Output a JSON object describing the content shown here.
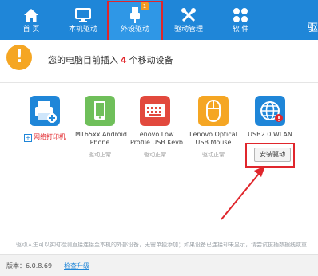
{
  "nav": {
    "items": [
      {
        "label": "首 页",
        "icon": "home-icon"
      },
      {
        "label": "本机驱动",
        "icon": "monitor-icon"
      },
      {
        "label": "外设驱动",
        "icon": "usb-icon",
        "badge": "1",
        "active": true
      },
      {
        "label": "驱动管理",
        "icon": "tools-icon"
      },
      {
        "label": "软 件",
        "icon": "apps-icon"
      }
    ],
    "brand_partial": "驱"
  },
  "alert": {
    "prefix": "您的电脑目前插入",
    "count": "4",
    "suffix": "个移动设备"
  },
  "devices": [
    {
      "name": "",
      "link_label": "网络打印机",
      "icon": "printer-icon"
    },
    {
      "name": "MT65xx Android Phone",
      "line1": "MT65xx Android",
      "line2": "Phone",
      "status": "驱动正常",
      "icon": "phone-icon"
    },
    {
      "name": "Lenovo Low Profile USB Keyb...",
      "line1": "Lenovo Low",
      "line2": "Profile USB Kevb...",
      "status": "驱动正常",
      "icon": "keyboard-icon"
    },
    {
      "name": "Lenovo Optical USB Mouse",
      "line1": "Lenovo Optical",
      "line2": "USB Mouse",
      "status": "驱动正常",
      "icon": "mouse-icon"
    },
    {
      "name": "USB2.0 WLAN",
      "line1": "USB2.0 WLAN",
      "line2": "",
      "status": "",
      "icon": "wlan-icon",
      "alert": true
    }
  ],
  "install_button": "安装驱动",
  "footer": {
    "note": "驱动人生可以实时检测直接连接至本机的外部设备，无需单独添加；如果设备已连接却未显示，请尝试拔插数据线或重",
    "version": "版本：6.0.8.69",
    "check_update": "检查升级"
  },
  "colors": {
    "topbar": "#1f86d8",
    "highlight_red": "#e0262c",
    "warning": "#f5a623"
  }
}
